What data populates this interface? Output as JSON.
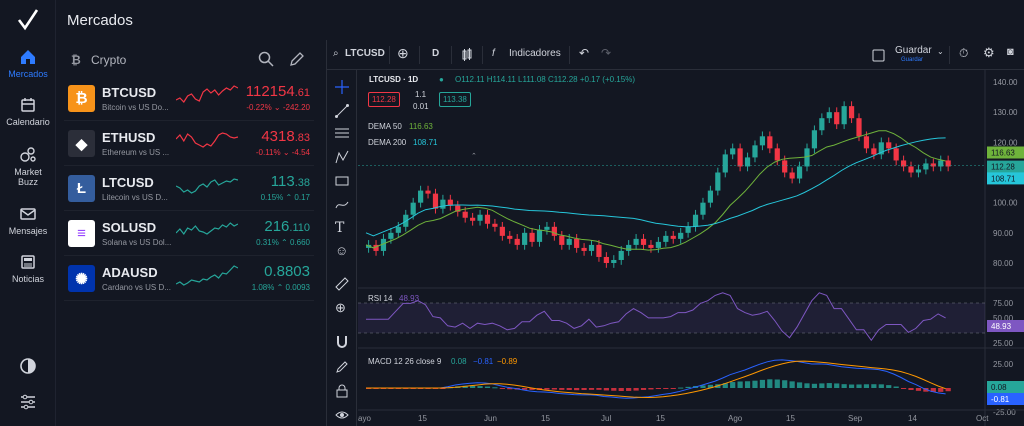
{
  "app": {
    "title": "Mercados"
  },
  "nav": {
    "items": [
      {
        "label": "Mercados",
        "icon": "home-icon"
      },
      {
        "label": "Calendario",
        "icon": "calendar-icon"
      },
      {
        "label": "Market Buzz",
        "icon": "buzz-icon"
      },
      {
        "label": "Mensajes",
        "icon": "mail-icon"
      },
      {
        "label": "Noticias",
        "icon": "news-icon"
      }
    ],
    "active_color": "#2e7bff"
  },
  "watchlist": {
    "category_icon": "bitcoin-icon",
    "category": "Crypto",
    "rows": [
      {
        "symbol": "BTCUSD",
        "desc": "Bitcoin vs US Do...",
        "price_main": "112154",
        "price_dec": ".61",
        "change": "-0.22% ",
        "change_abs": "-242.20",
        "dir": "dn",
        "logo_color": "#f7931a",
        "logo_char": "₿",
        "spark": [
          14,
          16,
          12,
          18,
          20,
          15,
          13,
          22,
          25,
          21,
          24,
          19,
          23,
          26,
          24,
          28,
          26
        ]
      },
      {
        "symbol": "ETHUSD",
        "desc": "Ethereum vs US ...",
        "price_main": "4318",
        "price_dec": ".83",
        "change": "-0.11% ",
        "change_abs": "-4.54",
        "dir": "dn",
        "logo_color": "#2b2e39",
        "logo_char": "◆",
        "spark": [
          20,
          24,
          18,
          25,
          22,
          16,
          14,
          12,
          15,
          13,
          18,
          24,
          26,
          25,
          22,
          21,
          22
        ]
      },
      {
        "symbol": "LTCUSD",
        "desc": "Litecoin vs US D...",
        "price_main": "113",
        "price_dec": ".38",
        "change": "0.15% ",
        "change_abs": "0.17",
        "dir": "up",
        "logo_color": "#345d9d",
        "logo_char": "Ł",
        "spark": [
          18,
          16,
          12,
          14,
          11,
          13,
          18,
          20,
          17,
          22,
          24,
          19,
          21,
          23,
          22,
          25,
          24
        ]
      },
      {
        "symbol": "SOLUSD",
        "desc": "Solana vs US Dol...",
        "price_main": "216",
        "price_dec": ".110",
        "change": "0.31% ",
        "change_abs": "0.660",
        "dir": "up",
        "logo_color": "#ffffff",
        "logo_char": "≡",
        "spark": [
          16,
          20,
          15,
          21,
          19,
          23,
          18,
          17,
          15,
          18,
          21,
          20,
          24,
          22,
          26,
          23,
          25
        ]
      },
      {
        "symbol": "ADAUSD",
        "desc": "Cardano vs US D...",
        "price_main": "0.8803",
        "price_dec": "",
        "change": "1.08% ",
        "change_abs": "0.0093",
        "dir": "up",
        "logo_color": "#0033ad",
        "logo_char": "✺",
        "spark": [
          10,
          12,
          9,
          11,
          14,
          13,
          12,
          15,
          14,
          17,
          19,
          16,
          21,
          20,
          24,
          28,
          26
        ]
      }
    ]
  },
  "toolbar": {
    "symbol": "LTCUSD",
    "interval": "D",
    "indicators": "Indicadores",
    "save": "Guardar",
    "save_sub": "Guardar"
  },
  "legend": {
    "title": "LTCUSD · 1D",
    "ohlc": "O112.11 H114.11 L111.08 C112.28 +0.17 (+0.15%)",
    "sell": "112.28",
    "spread_a": "1.1",
    "spread_b": "0.01",
    "buy": "113.38",
    "dema50": "DEMA 50",
    "dema50_val": "116.63",
    "dema200": "DEMA 200",
    "dema200_val": "108.71",
    "rsi": "RSI 14",
    "rsi_val": "48.93",
    "macd": "MACD 12 26 close 9",
    "macd_a": "0.08",
    "macd_b": "−0.81",
    "macd_c": "−0.89"
  },
  "chart_data": {
    "type": "candlestick",
    "price_ticks": [
      "140.00",
      "130.00",
      "120.00",
      "110.00",
      "100.00",
      "90.00",
      "80.00"
    ],
    "price_labels": [
      {
        "v": "116.63",
        "c": "#6fb33b"
      },
      {
        "v": "112.28",
        "c": "#26a69a"
      },
      {
        "v": "108.71",
        "c": "#26c6da"
      }
    ],
    "rsi_ticks": [
      "75.00",
      "50.00",
      "25.00"
    ],
    "rsi_label": "48.93",
    "macd_ticks": [
      "25.00",
      "0.00",
      "-25.00"
    ],
    "macd_labels": [
      {
        "v": "0.08",
        "c": "#26a69a"
      },
      {
        "v": "-0.81",
        "c": "#2962ff"
      }
    ],
    "x_labels": [
      "ayo",
      "15",
      "Jun",
      "15",
      "Jul",
      "15",
      "Ago",
      "15",
      "Sep",
      "14",
      "Oct"
    ],
    "closes": [
      86,
      84,
      88,
      90,
      92,
      96,
      100,
      104,
      103,
      98,
      101,
      99,
      97,
      95,
      94,
      96,
      93,
      92,
      89,
      88,
      86,
      90,
      87,
      91,
      92,
      89,
      86,
      88,
      85,
      84,
      86,
      82,
      80,
      81,
      84,
      86,
      88,
      86,
      85,
      87,
      89,
      88,
      90,
      92,
      96,
      100,
      104,
      110,
      116,
      118,
      112,
      115,
      119,
      122,
      118,
      114,
      110,
      108,
      112,
      118,
      124,
      128,
      130,
      126,
      132,
      128,
      122,
      118,
      116,
      120,
      118,
      114,
      112,
      110,
      111,
      113,
      112,
      114,
      112
    ]
  }
}
